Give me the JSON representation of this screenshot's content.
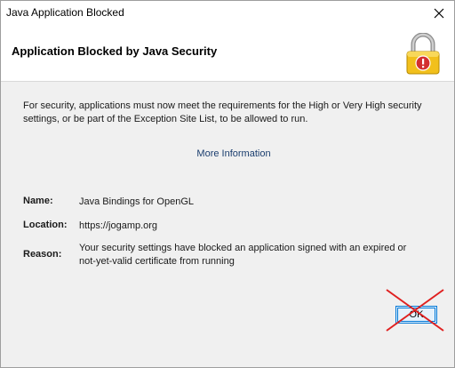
{
  "window": {
    "title": "Java Application Blocked",
    "close_icon": "close-icon"
  },
  "header": {
    "title": "Application Blocked by Java Security",
    "icon": "padlock-warning-icon"
  },
  "content": {
    "description": "For security, applications must now meet the requirements for the High or Very High security settings, or be part of the Exception Site List, to be allowed to run.",
    "more_info_label": "More Information",
    "name_label": "Name:",
    "name_value": "Java Bindings for OpenGL",
    "location_label": "Location:",
    "location_value": "https://jogamp.org",
    "reason_label": "Reason:",
    "reason_value": "Your security settings have blocked an application signed with an expired or not-yet-valid certificate from running"
  },
  "footer": {
    "ok_label": "OK",
    "overlay_icon": "red-cross-annotation"
  },
  "colors": {
    "link": "#1a3d6e",
    "lock_body": "#f2c01c",
    "warning_badge": "#d32f2f",
    "annotation_red": "#e02020",
    "button_border": "#0078d7"
  }
}
